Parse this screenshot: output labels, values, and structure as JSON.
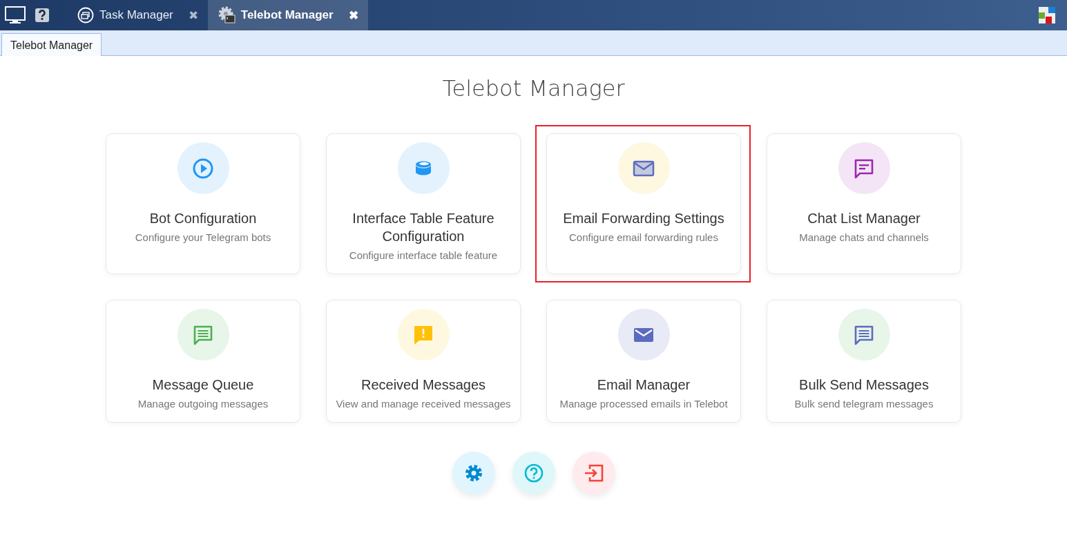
{
  "top_tabs": [
    {
      "label": "Task Manager",
      "kind": "window",
      "close": "✖",
      "selected": false
    },
    {
      "label": "Telebot Manager",
      "kind": "gear",
      "close": "✖",
      "selected": true
    }
  ],
  "sub_tabs": [
    {
      "label": "Telebot Manager",
      "selected": true
    }
  ],
  "title": "Telebot Manager",
  "cards": [
    {
      "title": "Bot Configuration",
      "subtitle": "Configure your Telegram bots",
      "kind": "play",
      "color": "#2196f3",
      "highlighted": false
    },
    {
      "title": "Interface Table Feature Configuration",
      "subtitle": "Configure interface table feature",
      "kind": "database",
      "color": "#2196f3",
      "highlighted": false
    },
    {
      "title": "Email Forwarding Settings",
      "subtitle": "Configure email forwarding rules",
      "kind": "mail-outline",
      "color": "#5c6bc0",
      "highlighted": true
    },
    {
      "title": "Chat List Manager",
      "subtitle": "Manage chats and channels",
      "kind": "chat-outline",
      "color": "#9c27b0",
      "highlighted": false
    },
    {
      "title": "Message Queue",
      "subtitle": "Manage outgoing messages",
      "kind": "chat-lines",
      "color": "#4caf50",
      "highlighted": false
    },
    {
      "title": "Received Messages",
      "subtitle": "View and manage received messages",
      "kind": "chat-alert",
      "color": "#ffc107",
      "highlighted": false
    },
    {
      "title": "Email Manager",
      "subtitle": "Manage processed emails in Telebot",
      "kind": "mail",
      "color": "#5c6bc0",
      "highlighted": false
    },
    {
      "title": "Bulk Send Messages",
      "subtitle": "Bulk send telegram messages",
      "kind": "chat-lines",
      "color": "#5c6bc0",
      "highlighted": false
    }
  ],
  "actions": [
    {
      "kind": "settings"
    },
    {
      "kind": "help"
    },
    {
      "kind": "logout"
    }
  ]
}
